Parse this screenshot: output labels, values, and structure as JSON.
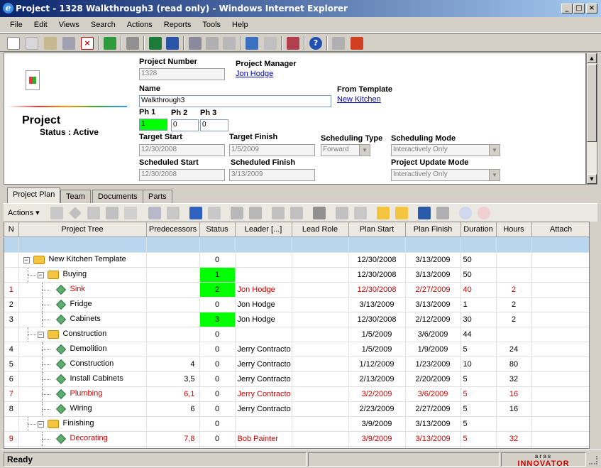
{
  "window": {
    "title": "Project - 1328 Walkthrough3 (read only) - Windows Internet Explorer"
  },
  "menu": [
    "File",
    "Edit",
    "Views",
    "Search",
    "Actions",
    "Reports",
    "Tools",
    "Help"
  ],
  "form": {
    "item_type": "Project",
    "status": "Status : Active",
    "project_number_label": "Project Number",
    "project_number": "1328",
    "project_manager_label": "Project Manager",
    "project_manager": "Jon Hodge",
    "name_label": "Name",
    "name": "Walkthrough3",
    "from_template_label": "From Template",
    "from_template": "New Kitchen",
    "ph1_label": "Ph 1",
    "ph1": "1",
    "ph2_label": "Ph 2",
    "ph2": "0",
    "ph3_label": "Ph 3",
    "ph3": "0",
    "target_start_label": "Target Start",
    "target_start": "12/30/2008",
    "target_finish_label": "Target Finish",
    "target_finish": "1/5/2009",
    "scheduling_type_label": "Scheduling Type",
    "scheduling_type": "Forward",
    "scheduling_mode_label": "Scheduling Mode",
    "scheduling_mode": "Interactively Only",
    "scheduled_start_label": "Scheduled Start",
    "scheduled_start": "12/30/2008",
    "scheduled_finish_label": "Scheduled Finish",
    "scheduled_finish": "3/13/2009",
    "project_update_mode_label": "Project Update Mode",
    "project_update_mode": "Interactively Only"
  },
  "tabs": [
    "Project Plan",
    "Team",
    "Documents",
    "Parts"
  ],
  "grid_toolbar": {
    "actions": "Actions"
  },
  "grid": {
    "columns": [
      "N",
      "Project Tree",
      "Predecessors",
      "Status",
      "Leader [...]",
      "Lead Role",
      "Plan Start",
      "Plan Finish",
      "Duration",
      "Hours",
      "Attach"
    ],
    "rows": [
      {
        "n": "",
        "name": "New Kitchen Template",
        "pred": "",
        "status": "0",
        "leader": "",
        "start": "12/30/2008",
        "finish": "3/13/2009",
        "dur": "50",
        "hours": ""
      },
      {
        "n": "",
        "name": "Buying",
        "pred": "",
        "status": "1",
        "leader": "",
        "start": "12/30/2008",
        "finish": "3/13/2009",
        "dur": "50",
        "hours": ""
      },
      {
        "n": "1",
        "name": "Sink",
        "pred": "",
        "status": "2",
        "leader": "Jon Hodge",
        "start": "12/30/2008",
        "finish": "2/27/2009",
        "dur": "40",
        "hours": "2"
      },
      {
        "n": "2",
        "name": "Fridge",
        "pred": "",
        "status": "0",
        "leader": "Jon Hodge",
        "start": "3/13/2009",
        "finish": "3/13/2009",
        "dur": "1",
        "hours": "2"
      },
      {
        "n": "3",
        "name": "Cabinets",
        "pred": "",
        "status": "3",
        "leader": "Jon Hodge",
        "start": "12/30/2008",
        "finish": "2/12/2009",
        "dur": "30",
        "hours": "2"
      },
      {
        "n": "",
        "name": "Construction",
        "pred": "",
        "status": "0",
        "leader": "",
        "start": "1/5/2009",
        "finish": "3/6/2009",
        "dur": "44",
        "hours": ""
      },
      {
        "n": "4",
        "name": "Demolition",
        "pred": "",
        "status": "0",
        "leader": "Jerry Contracto",
        "start": "1/5/2009",
        "finish": "1/9/2009",
        "dur": "5",
        "hours": "24"
      },
      {
        "n": "5",
        "name": "Construction",
        "pred": "4",
        "status": "0",
        "leader": "Jerry Contracto",
        "start": "1/12/2009",
        "finish": "1/23/2009",
        "dur": "10",
        "hours": "80"
      },
      {
        "n": "6",
        "name": "Install Cabinets",
        "pred": "3,5",
        "status": "0",
        "leader": "Jerry Contracto",
        "start": "2/13/2009",
        "finish": "2/20/2009",
        "dur": "5",
        "hours": "32"
      },
      {
        "n": "7",
        "name": "Plumbing",
        "pred": "6,1",
        "status": "0",
        "leader": "Jerry Contracto",
        "start": "3/2/2009",
        "finish": "3/6/2009",
        "dur": "5",
        "hours": "16"
      },
      {
        "n": "8",
        "name": "Wiring",
        "pred": "6",
        "status": "0",
        "leader": "Jerry Contracto",
        "start": "2/23/2009",
        "finish": "2/27/2009",
        "dur": "5",
        "hours": "16"
      },
      {
        "n": "",
        "name": "Finishing",
        "pred": "",
        "status": "0",
        "leader": "",
        "start": "3/9/2009",
        "finish": "3/13/2009",
        "dur": "5",
        "hours": ""
      },
      {
        "n": "9",
        "name": "Decorating",
        "pred": "7,8",
        "status": "0",
        "leader": "Bob Painter",
        "start": "3/9/2009",
        "finish": "3/13/2009",
        "dur": "5",
        "hours": "32"
      }
    ]
  },
  "statusbar": {
    "text": "Ready",
    "brand_top": "aras",
    "brand": "INNOVATOR"
  }
}
